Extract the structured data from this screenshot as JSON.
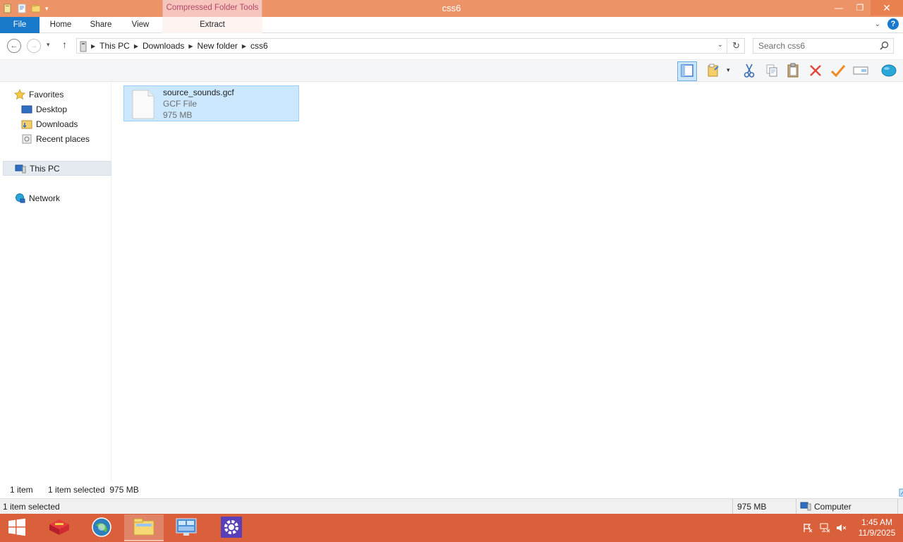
{
  "window": {
    "title": "css6",
    "context_tab_header": "Compressed Folder Tools",
    "controls": {
      "minimize": "—",
      "restore": "❐",
      "close": "✕"
    }
  },
  "ribbon": {
    "tabs": [
      "File",
      "Home",
      "Share",
      "View",
      "Extract"
    ],
    "help": "?"
  },
  "address": {
    "breadcrumb": [
      "This PC",
      "Downloads",
      "New folder",
      "css6"
    ],
    "search_placeholder": "Search css6"
  },
  "toolbar": {
    "icons": [
      "preview-pane-icon",
      "folder-options-icon",
      "cut-icon",
      "copy-icon",
      "paste-icon",
      "delete-icon",
      "check-icon",
      "rename-icon",
      "globe-icon"
    ]
  },
  "nav": {
    "favorites": "Favorites",
    "favorites_items": [
      "Desktop",
      "Downloads",
      "Recent places"
    ],
    "this_pc": "This PC",
    "network": "Network"
  },
  "files": [
    {
      "name": "source_sounds.gcf",
      "type": "GCF File",
      "size": "975 MB",
      "selected": true
    }
  ],
  "status": {
    "item_count": "1 item",
    "selection": "1 item selected  975 MB"
  },
  "details": {
    "selected": "1 item selected",
    "size": "975 MB",
    "location": "Computer"
  },
  "taskbar": {
    "time": "1:45 AM",
    "date": "11/9/2025",
    "accent": "#d9603b"
  }
}
